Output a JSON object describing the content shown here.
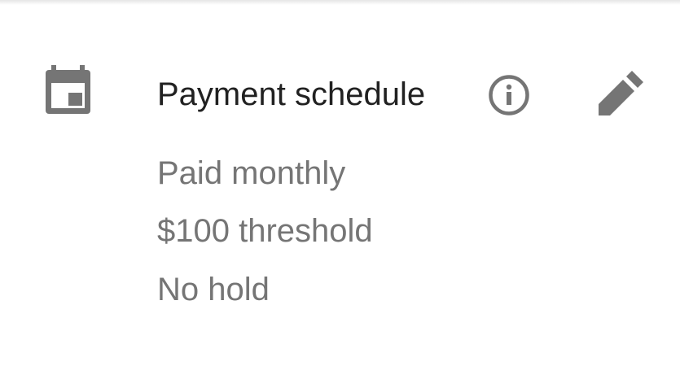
{
  "section": {
    "title": "Payment schedule",
    "icon": "calendar-icon",
    "info_icon": "info-icon",
    "edit_icon": "pencil-icon",
    "details": [
      "Paid monthly",
      "$100 threshold",
      "No hold"
    ]
  },
  "colors": {
    "title": "#212121",
    "detail_text": "#757575",
    "icon": "#757575",
    "background": "#ffffff"
  }
}
